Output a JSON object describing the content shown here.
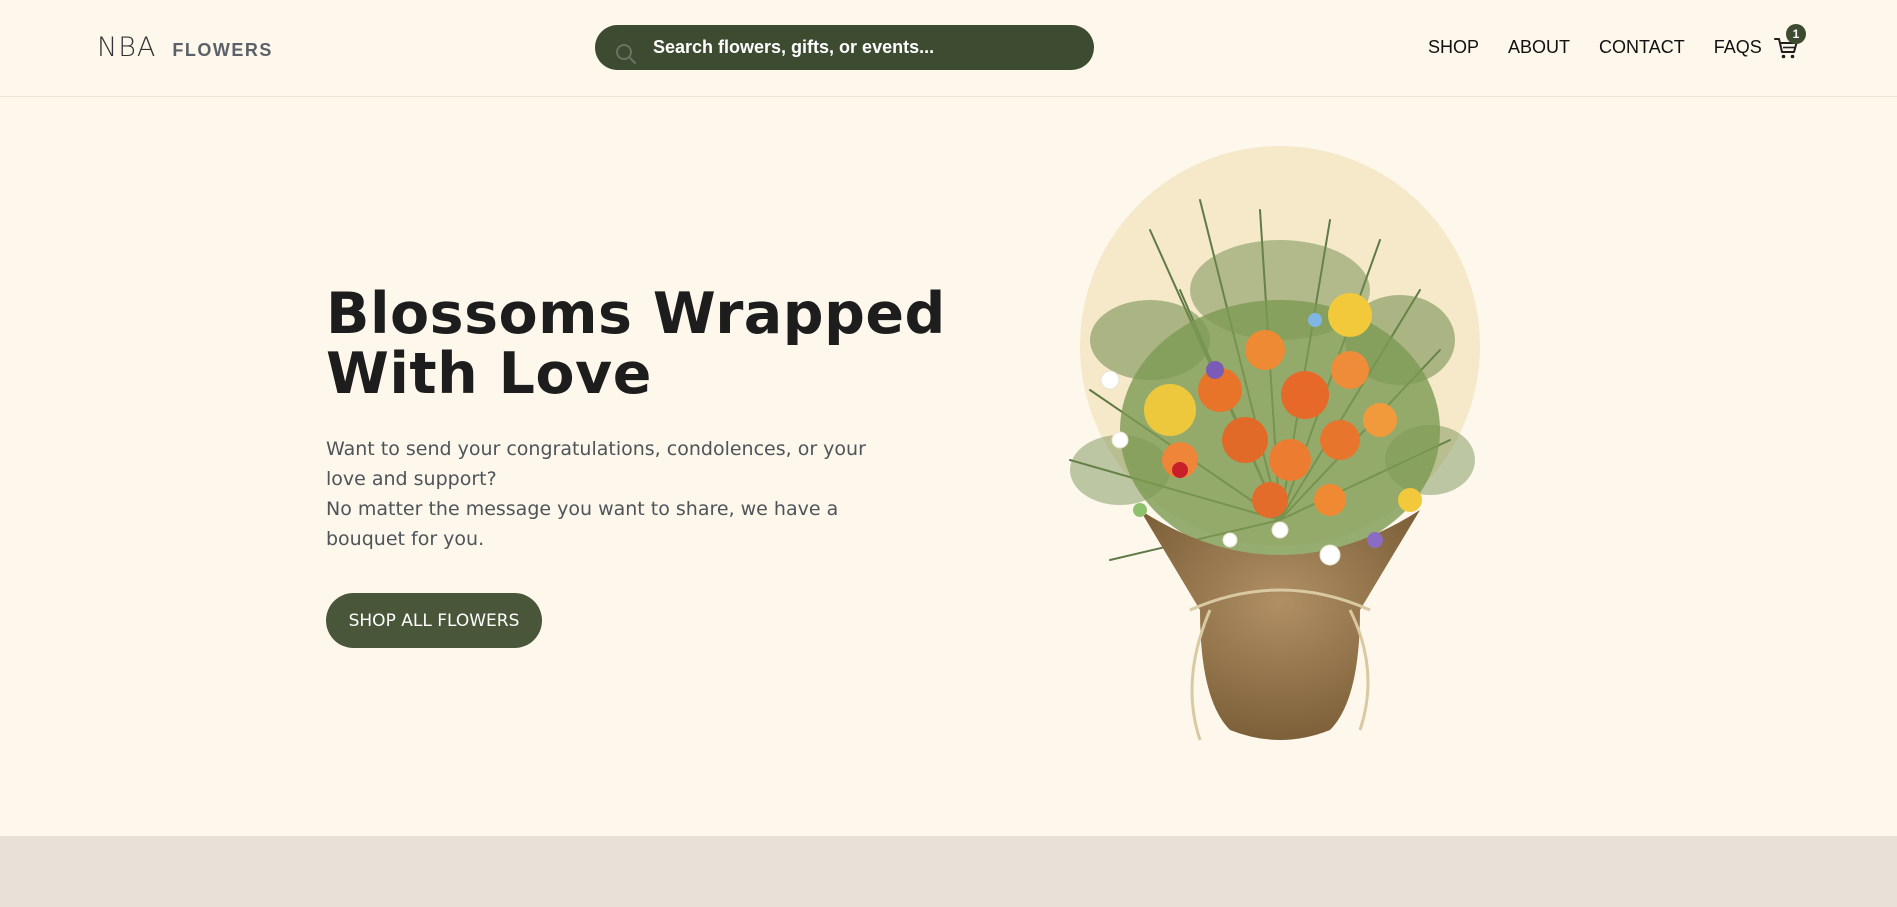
{
  "brand": {
    "mark": "NBA",
    "name": "FLOWERS"
  },
  "search": {
    "placeholder": "Search flowers, gifts, or events...",
    "icon": "search-icon"
  },
  "nav": {
    "items": [
      {
        "label": "SHOP"
      },
      {
        "label": "ABOUT"
      },
      {
        "label": "CONTACT"
      },
      {
        "label": "FAQS"
      }
    ],
    "cart": {
      "icon": "cart-icon",
      "count": "1"
    }
  },
  "hero": {
    "title_line1": "Blossoms Wrapped",
    "title_line2": "With Love",
    "paragraph1": "Want to send your congratulations, condolences, or your love and support?",
    "paragraph2": "No matter the message you want to share, we have a bouquet for you.",
    "cta_label": "SHOP ALL FLOWERS",
    "image": "bouquet-image"
  },
  "colors": {
    "background": "#fdf7ec",
    "accent": "#3d4b31",
    "button": "#49563a",
    "circle": "#f6e9ca",
    "footer_band": "#e8e1d7"
  }
}
